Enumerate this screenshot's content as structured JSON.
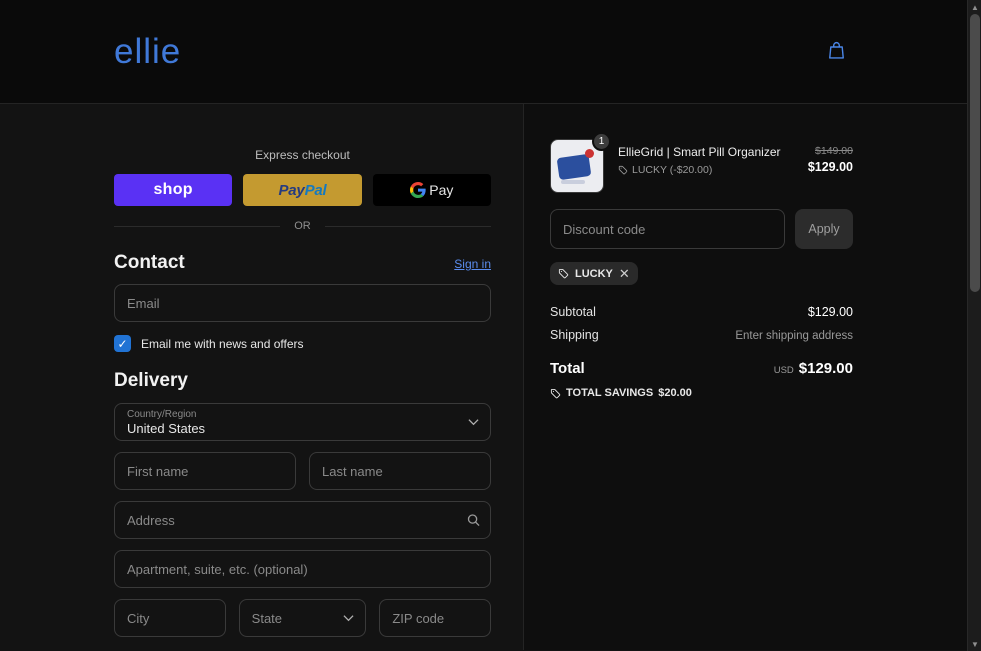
{
  "colors": {
    "accent_blue": "#4a86e8",
    "logo_blue": "#4079d8",
    "shop_purple": "#5a31f4",
    "paypal_gold": "#c49a30",
    "checkbox_blue": "#2173d4",
    "background_dark": "#131313"
  },
  "header": {
    "logo_text": "ellie"
  },
  "express_checkout": {
    "label": "Express checkout",
    "shop_button_label": "shop",
    "paypal_label_part1": "Pay",
    "paypal_label_part2": "Pal",
    "gpay_label": "Pay",
    "or_divider": "OR"
  },
  "contact": {
    "heading": "Contact",
    "sign_in_link": "Sign in",
    "email_placeholder": "Email",
    "newsletter_label": "Email me with news and offers",
    "newsletter_checked": "✓"
  },
  "delivery": {
    "heading": "Delivery",
    "country_label": "Country/Region",
    "country_value": "United States",
    "first_name_placeholder": "First name",
    "last_name_placeholder": "Last name",
    "address_placeholder": "Address",
    "apartment_placeholder": "Apartment, suite, etc. (optional)",
    "city_placeholder": "City",
    "state_value": "State",
    "zip_placeholder": "ZIP code"
  },
  "order_summary": {
    "item": {
      "quantity": "1",
      "title": "EllieGrid | Smart Pill Organizer",
      "discount_note": "LUCKY (-$20.00)",
      "original_price": "$149.00",
      "current_price": "$129.00"
    },
    "discount_code": {
      "placeholder": "Discount code",
      "apply_button": "Apply",
      "applied_tag": "LUCKY",
      "remove_tag": "✕"
    },
    "subtotal_label": "Subtotal",
    "subtotal_value": "$129.00",
    "shipping_label": "Shipping",
    "shipping_value": "Enter shipping address",
    "total_label": "Total",
    "total_currency": "USD",
    "total_value": "$129.00",
    "savings_label": "TOTAL SAVINGS",
    "savings_value": "$20.00"
  }
}
